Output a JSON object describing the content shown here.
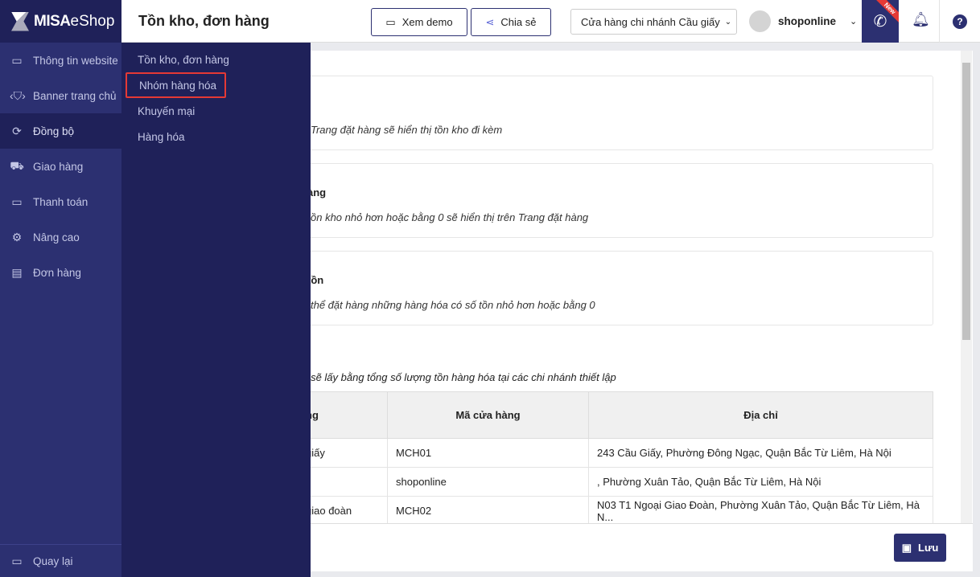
{
  "brand": {
    "logo_bold": "MISA",
    "logo_light": "eShop"
  },
  "sidebar": {
    "items": [
      {
        "label": "Thông tin website",
        "icon": "browser-icon"
      },
      {
        "label": "Banner trang chủ",
        "icon": "shirt-icon"
      },
      {
        "label": "Đồng bộ",
        "icon": "sync-icon",
        "active": true
      },
      {
        "label": "Giao hàng",
        "icon": "truck-icon"
      },
      {
        "label": "Thanh toán",
        "icon": "card-icon"
      },
      {
        "label": "Nâng cao",
        "icon": "gear-icon"
      },
      {
        "label": "Đơn hàng",
        "icon": "clipboard-icon"
      }
    ],
    "back": "Quay lại"
  },
  "submenu": {
    "items": [
      "Tồn kho, đơn hàng",
      "Nhóm hàng hóa",
      "Khuyến mại",
      "Hàng hóa"
    ],
    "highlighted": "Nhóm hàng hóa"
  },
  "header": {
    "title": "Tồn kho, đơn hàng",
    "demo": "Xem demo",
    "share": "Chia sẻ",
    "store": "Cửa hàng chi nhánh Cầu giấy",
    "user": "shoponline",
    "new_badge": "New"
  },
  "cards": [
    {
      "title": "",
      "desc": "Trang đặt hàng sẽ hiển thị tồn kho đi kèm"
    },
    {
      "title": "àng",
      "desc": "ồn kho nhỏ hơn hoặc bằng 0 sẽ hiển thị trên Trang đặt hàng"
    },
    {
      "title": "tồn",
      "desc": "thể đặt hàng những hàng hóa có số tồn nhỏ hơn hoặc bằng 0"
    }
  ],
  "stock_note": "ng sẽ lấy bằng tổng số lượng tồn hàng hóa tại các chi nhánh thiết lập",
  "table": {
    "headers": [
      "ng",
      "Mã cửa hàng",
      "Địa chỉ"
    ],
    "rows": [
      [
        "giấy",
        "MCH01",
        "243 Cầu Giấy, Phường Đông Ngạc, Quận Bắc Từ Liêm, Hà Nội"
      ],
      [
        "",
        "shoponline",
        ", Phường Xuân Tảo, Quận Bắc Từ Liêm, Hà Nội"
      ],
      [
        "giao đoàn",
        "MCH02",
        "N03 T1 Ngoại Giao Đoàn, Phường Xuân Tảo, Quận Bắc Từ Liêm, Hà N..."
      ]
    ]
  },
  "save": "Lưu"
}
